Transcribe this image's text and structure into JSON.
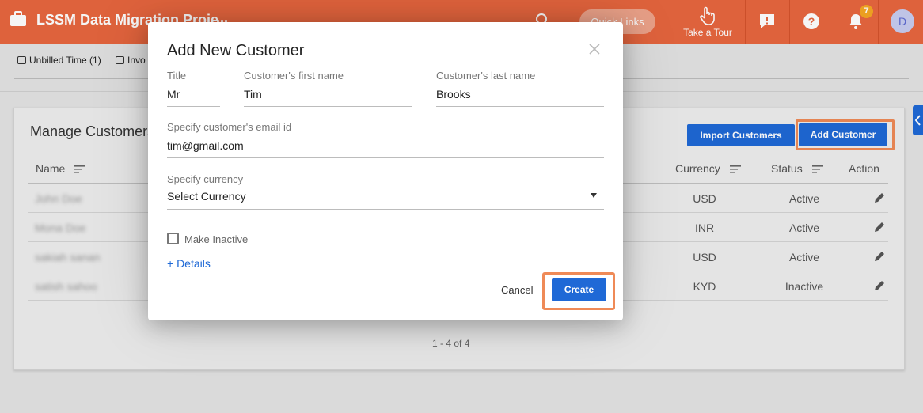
{
  "header": {
    "app_title": "LSSM Data Migration Proje",
    "more": "...",
    "quick_links": "Quick Links",
    "take_tour": "Take a Tour",
    "notification_count": "7",
    "avatar_initial": "D"
  },
  "subnav": {
    "tabs": [
      {
        "label": "Unbilled Time (1)"
      },
      {
        "label": "Invo"
      }
    ]
  },
  "card": {
    "title": "Manage Customers",
    "import_button": "Import Customers",
    "add_button": "Add Customer",
    "columns": {
      "name": "Name",
      "currency": "Currency",
      "status": "Status",
      "action": "Action"
    },
    "rows": [
      {
        "name": "John Doe",
        "currency": "USD",
        "status": "Active"
      },
      {
        "name": "Mona Doe",
        "currency": "INR",
        "status": "Active"
      },
      {
        "name": "sakiah sanan",
        "currency": "USD",
        "status": "Active"
      },
      {
        "name": "satish sahoo",
        "currency": "KYD",
        "status": "Inactive"
      }
    ],
    "pagination": "1 - 4 of 4"
  },
  "modal": {
    "title": "Add New Customer",
    "title_field": {
      "label": "Title",
      "value": "Mr"
    },
    "first_name": {
      "label": "Customer's first name",
      "value": "Tim"
    },
    "last_name": {
      "label": "Customer's last name",
      "value": "Brooks"
    },
    "email": {
      "label": "Specify customer's email id",
      "value": "tim@gmail.com"
    },
    "currency": {
      "label": "Specify currency",
      "value": "Select Currency"
    },
    "make_inactive": "Make Inactive",
    "details_link": "+ Details",
    "cancel": "Cancel",
    "create": "Create"
  },
  "colors": {
    "header_bg": "#e8673f",
    "primary_button": "#1f69d6",
    "highlight_outline": "#ef8a57"
  }
}
